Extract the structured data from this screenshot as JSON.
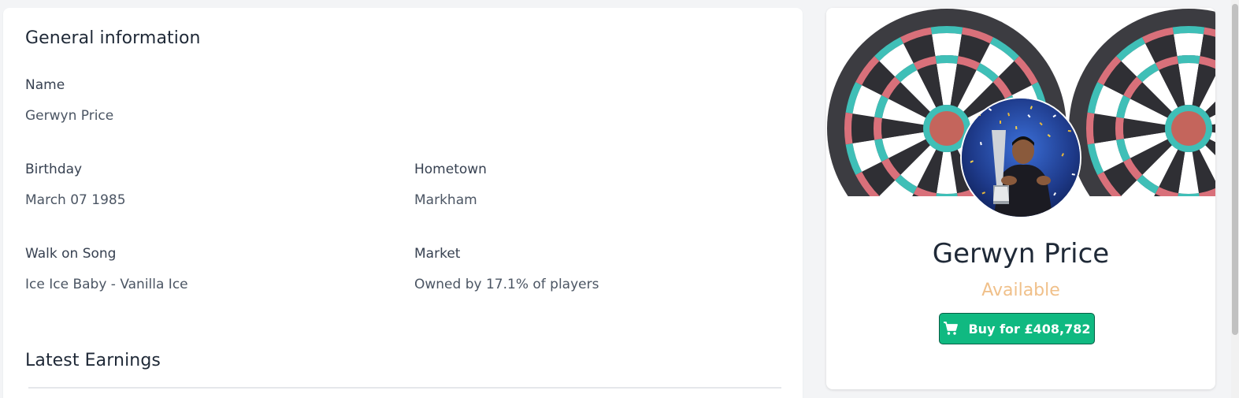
{
  "general": {
    "title": "General information",
    "name_label": "Name",
    "name_value": "Gerwyn Price",
    "birthday_label": "Birthday",
    "birthday_value": "March 07 1985",
    "hometown_label": "Hometown",
    "hometown_value": "Markham",
    "song_label": "Walk on Song",
    "song_value": "Ice Ice Baby - Vanilla Ice",
    "market_label": "Market",
    "market_value": "Owned by 17.1% of players"
  },
  "earnings": {
    "title": "Latest Earnings"
  },
  "profile": {
    "player_name": "Gerwyn Price",
    "status": "Available",
    "buy_label": "Buy for £408,782",
    "banner_icon": "dartboard-icon",
    "cart_icon": "cart-icon"
  },
  "colors": {
    "accent_green": "#10b981",
    "status_available": "#f0c08a",
    "dart_teal": "#3fbfb7",
    "dart_red": "#d9707a",
    "dart_dark": "#3c3c41"
  }
}
